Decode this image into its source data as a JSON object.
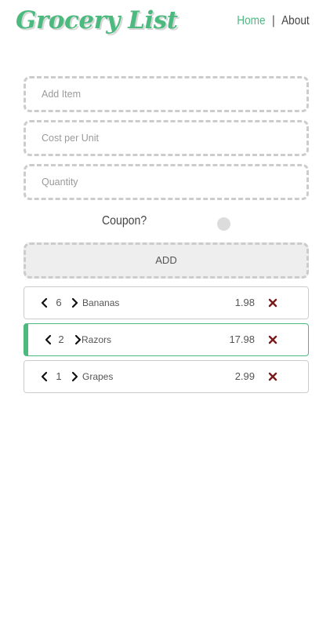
{
  "header": {
    "logo": "Grocery List",
    "nav": {
      "home": "Home",
      "separator": "|",
      "about": "About"
    }
  },
  "form": {
    "item_placeholder": "Add Item",
    "item_value": "",
    "cost_placeholder": "Cost per Unit",
    "cost_value": "",
    "quantity_placeholder": "Quantity",
    "quantity_value": "",
    "coupon_label": "Coupon?",
    "coupon_enabled": false,
    "add_label": "ADD"
  },
  "items": [
    {
      "quantity": "6",
      "name": "Bananas",
      "price": "1.98",
      "selected": false
    },
    {
      "quantity": "2",
      "name": "Razors",
      "price": "17.98",
      "selected": true
    },
    {
      "quantity": "1",
      "name": "Grapes",
      "price": "2.99",
      "selected": false
    }
  ],
  "icons": {
    "decrement": "chevron-left-icon",
    "increment": "chevron-right-icon",
    "remove": "close-icon"
  },
  "colors": {
    "accent": "#4cba7f",
    "remove": "#7a1a1a",
    "dashed_border": "#cccccc",
    "add_button_bg": "#eeeeee"
  }
}
